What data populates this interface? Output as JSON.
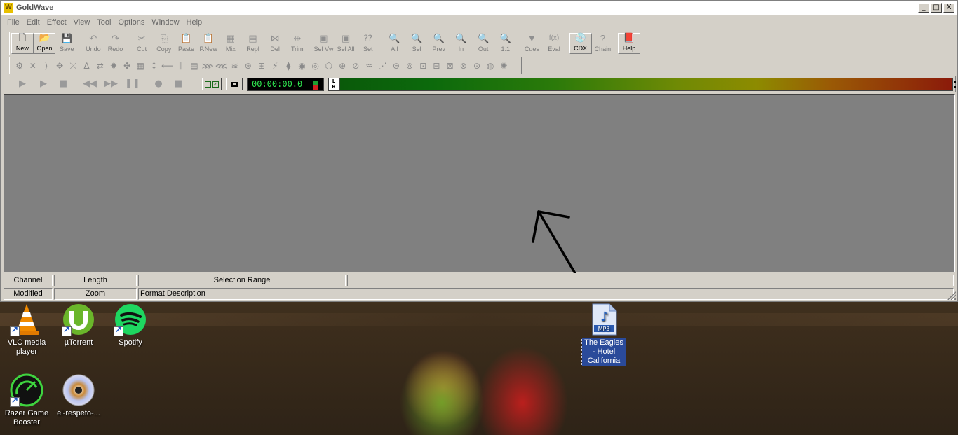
{
  "window": {
    "title": "GoldWave",
    "logo_letter": "W",
    "controls": [
      "_",
      "□",
      "X"
    ]
  },
  "menu": [
    "File",
    "Edit",
    "Effect",
    "View",
    "Tool",
    "Options",
    "Window",
    "Help"
  ],
  "toolbar_main": [
    {
      "label": "New",
      "icon": "new-file-icon",
      "glyph": "🗋",
      "active": true
    },
    {
      "label": "Open",
      "icon": "open-folder-icon",
      "glyph": "📂",
      "active": true
    },
    {
      "label": "Save",
      "icon": "save-icon",
      "glyph": "💾",
      "active": false
    },
    {
      "label": "Undo",
      "icon": "undo-icon",
      "glyph": "↶",
      "active": false
    },
    {
      "label": "Redo",
      "icon": "redo-icon",
      "glyph": "↷",
      "active": false
    },
    {
      "label": "Cut",
      "icon": "scissors-icon",
      "glyph": "✂",
      "active": false
    },
    {
      "label": "Copy",
      "icon": "copy-icon",
      "glyph": "⎘",
      "active": false
    },
    {
      "label": "Paste",
      "icon": "paste-icon",
      "glyph": "📋",
      "active": false
    },
    {
      "label": "P.New",
      "icon": "paste-new-icon",
      "glyph": "📋",
      "active": false
    },
    {
      "label": "Mix",
      "icon": "mix-icon",
      "glyph": "▦",
      "active": false
    },
    {
      "label": "Repl",
      "icon": "replace-icon",
      "glyph": "▤",
      "active": false
    },
    {
      "label": "Del",
      "icon": "delete-icon",
      "glyph": "⋈",
      "active": false
    },
    {
      "label": "Trim",
      "icon": "trim-icon",
      "glyph": "⇹",
      "active": false
    },
    {
      "label": "Sel Vw",
      "icon": "select-view-icon",
      "glyph": "▣",
      "active": false
    },
    {
      "label": "Sel All",
      "icon": "select-all-icon",
      "glyph": "▣",
      "active": false
    },
    {
      "label": "Set",
      "icon": "set-selection-icon",
      "glyph": "⁇",
      "active": false
    },
    {
      "label": "All",
      "icon": "zoom-all-icon",
      "glyph": "🔍",
      "active": false
    },
    {
      "label": "Sel",
      "icon": "zoom-selection-icon",
      "glyph": "🔍",
      "active": false
    },
    {
      "label": "Prev",
      "icon": "zoom-previous-icon",
      "glyph": "🔍",
      "active": false
    },
    {
      "label": "In",
      "icon": "zoom-in-icon",
      "glyph": "🔍",
      "active": false
    },
    {
      "label": "Out",
      "icon": "zoom-out-icon",
      "glyph": "🔍",
      "active": false
    },
    {
      "label": "1:1",
      "icon": "zoom-1to1-icon",
      "glyph": "🔍",
      "active": false
    },
    {
      "label": "Cues",
      "icon": "cues-icon",
      "glyph": "▼",
      "active": false
    },
    {
      "label": "Eval",
      "icon": "expression-evaluator-icon",
      "glyph": "f(x)",
      "active": false
    },
    {
      "label": "CDX",
      "icon": "cd-extract-icon",
      "glyph": "💿",
      "active": true
    },
    {
      "label": "Chain",
      "icon": "batch-chain-icon",
      "glyph": "?",
      "active": false
    },
    {
      "label": "Help",
      "icon": "help-book-icon",
      "glyph": "📕",
      "active": true
    }
  ],
  "effects_toolbar_icons": [
    "dc-offset-icon",
    "doppler-icon",
    "dynamics-icon",
    "echo-icon",
    "fade-icon",
    "filter-icon",
    "flange-icon",
    "gear-icon",
    "invert-icon",
    "mechanize-icon",
    "offset-icon",
    "pan-icon",
    "pitch-icon",
    "playback-rate-icon",
    "resample-icon",
    "reverse-icon",
    "silence-icon",
    "spatial-icon",
    "stereo-icon",
    "time-warp-icon",
    "volume-icon",
    "volume-shape-icon",
    "auto-gain-icon",
    "noise-reduction-icon",
    "equalizer-icon",
    "compressor-icon",
    "pop-click-icon",
    "interpolate-icon",
    "channel-mixer-icon",
    "bandpass-icon",
    "lowpass-icon",
    "highpass-icon",
    "maximize-icon",
    "volume-match-icon",
    "spectrum-icon",
    "reverb-icon",
    "noise-gate-icon"
  ],
  "transport": {
    "play_icon": "play-icon",
    "time": "00:00:00.0",
    "lr_label_top": "L",
    "lr_label_bottom": "R"
  },
  "status": {
    "row1": [
      "Channel",
      "Length",
      "Selection Range",
      ""
    ],
    "row2": [
      "Modified",
      "Zoom",
      "Format Description"
    ]
  },
  "desktop_icons": [
    {
      "label": "VLC media player",
      "icon": "vlc-cone-icon",
      "shortcut": true
    },
    {
      "label": "µTorrent",
      "icon": "utorrent-icon",
      "shortcut": true
    },
    {
      "label": "Spotify",
      "icon": "spotify-icon",
      "shortcut": true
    },
    {
      "label": "Razer Game Booster",
      "icon": "razer-game-booster-icon",
      "shortcut": true
    },
    {
      "label": "el-respeto-...",
      "icon": "disc-icon",
      "shortcut": false
    },
    {
      "label": "The Eagles - Hotel California",
      "icon": "mp3-file-icon",
      "shortcut": false,
      "selected": true,
      "badge": "MP3"
    }
  ],
  "colors": {
    "window_bg": "#d4d0c8",
    "work_area": "#808080",
    "timer_text": "#2ee24e",
    "selection": "#2a4a9a"
  }
}
